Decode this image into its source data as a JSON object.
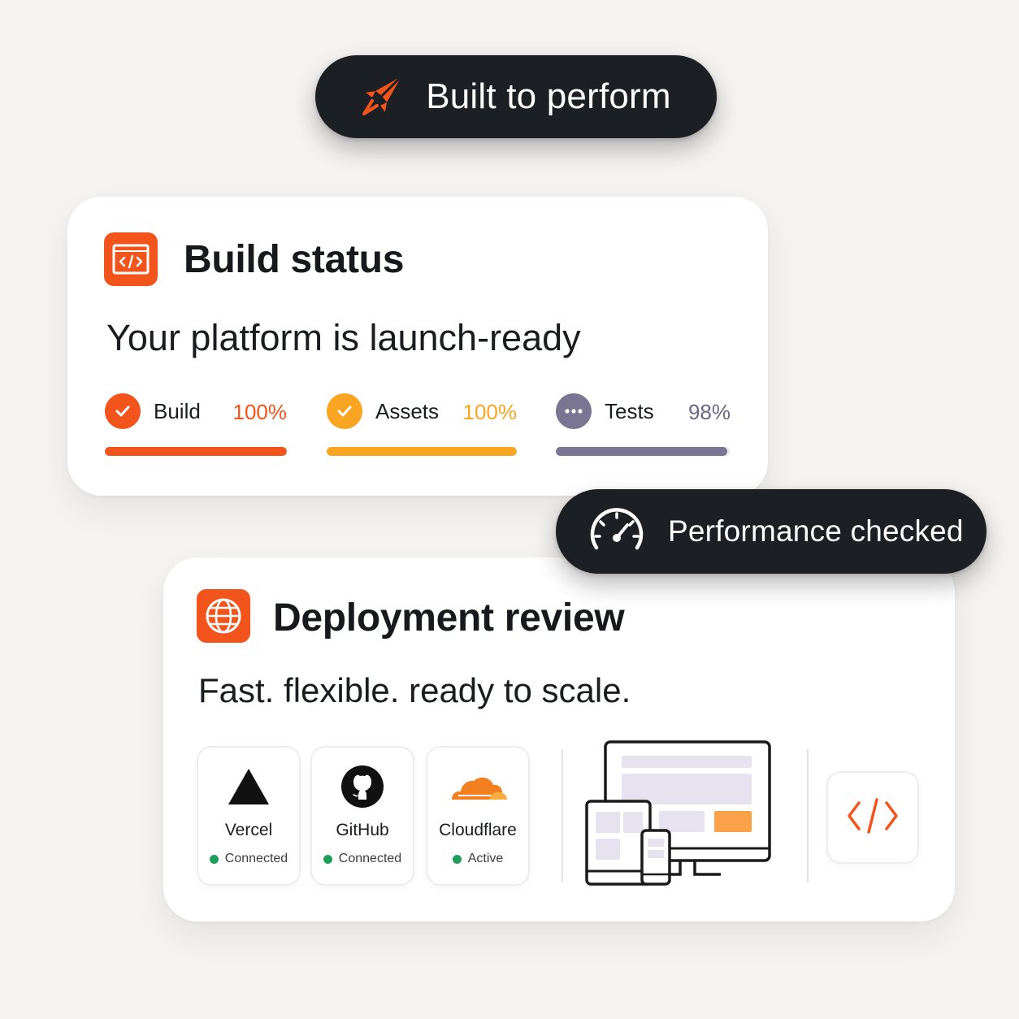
{
  "badges": {
    "top": {
      "label": "Built to perform",
      "icon": "rocket-icon"
    },
    "performance": {
      "label": "Performance checked",
      "icon": "speedometer-icon"
    }
  },
  "build_card": {
    "title": "Build status",
    "subtitle": "Your platform is launch-ready",
    "icon": "code-window-icon",
    "metrics": [
      {
        "label": "Build",
        "value": "100%",
        "progress": 100,
        "status": "complete",
        "color": "#f2541c"
      },
      {
        "label": "Assets",
        "value": "100%",
        "progress": 100,
        "status": "complete",
        "color": "#f8a621"
      },
      {
        "label": "Tests",
        "value": "98%",
        "progress": 98,
        "status": "in-progress",
        "color": "#7a7593"
      }
    ]
  },
  "deploy_card": {
    "title": "Deployment review",
    "subtitle": "Fast. flexible. ready to scale.",
    "icon": "globe-icon",
    "providers": [
      {
        "name": "Vercel",
        "status": "Connected",
        "icon": "vercel-triangle-icon"
      },
      {
        "name": "GitHub",
        "status": "Connected",
        "icon": "github-icon"
      },
      {
        "name": "Cloudflare",
        "status": "Active",
        "icon": "cloudflare-icon"
      }
    ],
    "status_color": "#1e9e5a",
    "extra_icons": [
      "responsive-devices-icon",
      "code-brackets-icon"
    ]
  },
  "colors": {
    "accent": "#f2541c",
    "dark": "#1c1f23",
    "background": "#f5f3f1"
  }
}
